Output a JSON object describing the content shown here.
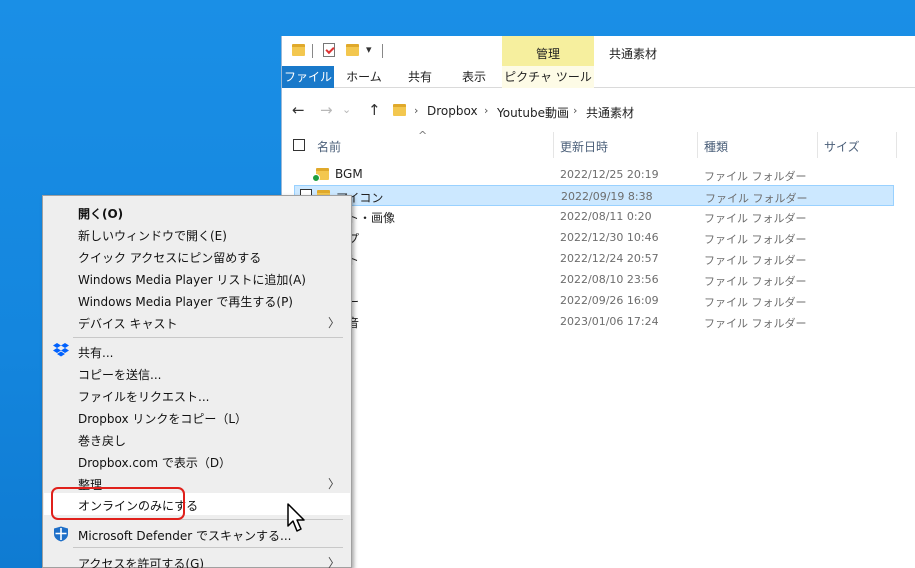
{
  "explorer": {
    "context_tab_header": "管理",
    "window_title": "共通素材",
    "ribbon_tabs": [
      "ファイル",
      "ホーム",
      "共有",
      "表示",
      "ピクチャ ツール"
    ],
    "breadcrumb": [
      "Dropbox",
      "Youtube動画",
      "共通素材"
    ],
    "columns": {
      "name": "名前",
      "date": "更新日時",
      "type": "種類",
      "size": "サイズ"
    },
    "rows": [
      {
        "name": "BGM",
        "date": "2022/12/25 20:19",
        "type": "ファイル フォルダー"
      },
      {
        "name": "アイコン",
        "date": "2022/09/19 8:38",
        "type": "ファイル フォルダー"
      },
      {
        "name": "スト・画像",
        "date": "2022/08/11 0:20",
        "type": "ファイル フォルダー"
      },
      {
        "name": "ップ",
        "date": "2022/12/30 10:46",
        "type": "ファイル フォルダー"
      },
      {
        "name": "ント",
        "date": "2022/12/24 20:57",
        "type": "ファイル フォルダー"
      },
      {
        "name": "ロ",
        "date": "2022/08/10 23:56",
        "type": "ファイル フォルダー"
      },
      {
        "name": "ダー",
        "date": "2022/09/26 16:09",
        "type": "ファイル フォルダー"
      },
      {
        "name": "果音",
        "date": "2023/01/06 17:24",
        "type": "ファイル フォルダー"
      }
    ]
  },
  "menu": {
    "items": [
      "開く(O)",
      "新しいウィンドウで開く(E)",
      "クイック アクセスにピン留めする",
      "Windows Media Player リストに追加(A)",
      "Windows Media Player で再生する(P)",
      "デバイス キャスト",
      "共有...",
      "コピーを送信...",
      "ファイルをリクエスト...",
      "Dropbox リンクをコピー（L）",
      "巻き戻し",
      "Dropbox.com で表示（D）",
      "整理",
      "オンラインのみにする",
      "Microsoft Defender でスキャンする...",
      "アクセスを許可する(G)"
    ],
    "submenu_arrow": "〉"
  },
  "icons": {
    "back": "←",
    "forward": "→",
    "dropdown": "⌄",
    "up": "↑",
    "sort": "^",
    "chevron": "›",
    "qat_dropdown": "▾"
  },
  "colors": {
    "desktop": "#1a8fe6",
    "file_tab": "#1979ca",
    "context_tab": "#f6ef9e",
    "selection": "#cce8ff",
    "highlight_box": "#e0201b",
    "dropbox": "#0061fe"
  }
}
